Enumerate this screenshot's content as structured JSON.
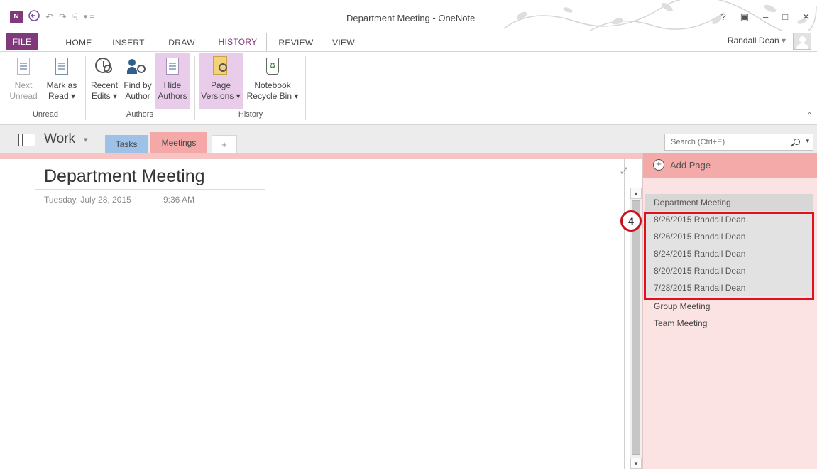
{
  "window": {
    "title": "Department Meeting - OneNote",
    "app_logo": "N",
    "controls": [
      "?",
      "▣",
      "–",
      "□",
      "✕"
    ]
  },
  "qat": {
    "back_icon": "back-icon",
    "undo": "↶",
    "redo": "↷",
    "touch": "☟",
    "dropdown": "▾ ="
  },
  "ribbon_tabs": [
    "FILE",
    "HOME",
    "INSERT",
    "DRAW",
    "HISTORY",
    "REVIEW",
    "VIEW"
  ],
  "active_tab": "HISTORY",
  "user": {
    "name": "Randall Dean",
    "caret": "▾"
  },
  "ribbon": {
    "unread_group": {
      "label": "Unread",
      "next_unread": [
        "Next",
        "Unread"
      ],
      "mark_as_read": [
        "Mark as",
        "Read ▾"
      ]
    },
    "authors_group": {
      "label": "Authors",
      "recent_edits": [
        "Recent",
        "Edits ▾"
      ],
      "find_by_author": [
        "Find by",
        "Author"
      ],
      "hide_authors": [
        "Hide",
        "Authors"
      ]
    },
    "history_group": {
      "label": "History",
      "page_versions": [
        "Page",
        "Versions ▾"
      ],
      "notebook_recycle_bin": [
        "Notebook",
        "Recycle Bin ▾"
      ]
    },
    "collapse": "^"
  },
  "notebook": {
    "name": "Work",
    "caret": "▾",
    "sections": [
      "Tasks",
      "Meetings"
    ],
    "add_section": "+",
    "search_placeholder": "Search (Ctrl+E)",
    "search_caret": "▾"
  },
  "page": {
    "title": "Department Meeting",
    "date": "Tuesday, July 28, 2015",
    "time": "9:36 AM",
    "expand": "⤢"
  },
  "scrollbar": {
    "up": "▲",
    "down": "▼"
  },
  "pagelist": {
    "add_page": "Add Page",
    "add_icon": "+",
    "selected_page": "Department Meeting",
    "versions": [
      "8/26/2015 Randall Dean",
      "8/26/2015 Randall Dean",
      "8/24/2015 Randall Dean",
      "8/20/2015 Randall Dean",
      "7/28/2015 Randall Dean"
    ],
    "other_pages": [
      "Group Meeting",
      "Team Meeting"
    ]
  },
  "callout": {
    "number": "4"
  },
  "colors": {
    "onenote_purple": "#80397b",
    "section_tasks": "#9ec1e8",
    "section_meetings": "#f4a9a8",
    "pagelist_bg": "#fbe3e3",
    "highlight_box": "#e0101c",
    "ribbon_active": "#e9cbea"
  }
}
